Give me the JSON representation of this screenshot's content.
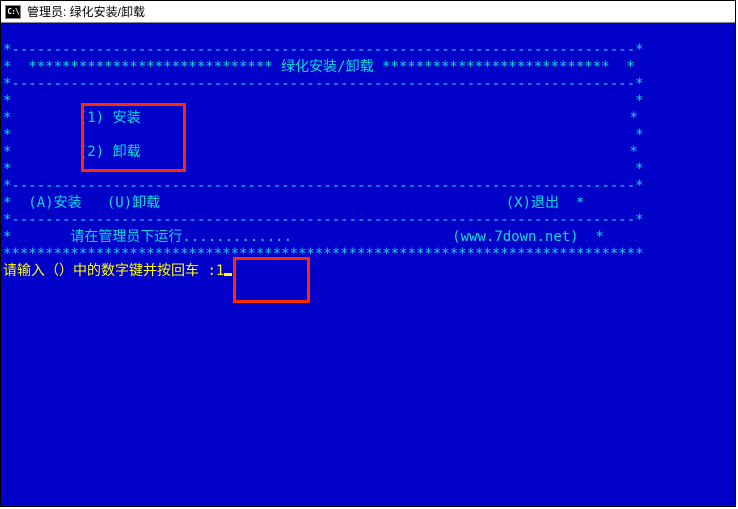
{
  "titlebar": {
    "icon_label": "C:\\",
    "title": "管理员:  绿化安装/卸载"
  },
  "console": {
    "top_border": "*--------------------------------------------------------------------------*",
    "header_line": "*  ***************************** 绿化安装/卸载 ***************************  *",
    "sep_line": "*--------------------------------------------------------------------------*",
    "blank_side": "*                                                                          *",
    "option1": "*        (1) 安装                                                          *",
    "option2": "*        (2) 卸载                                                          *",
    "menu_line_left": "*  (A)安装   (U)卸载",
    "menu_line_right": "(X)退出  *",
    "run_admin_left": "*       请在管理员下运行.............",
    "run_admin_right": "(www.7down.net)  *",
    "stars_line": "****************************************************************************",
    "prompt": "请输入（）中的数字键并按回车",
    "prompt_sep": ":",
    "input_value": "1"
  }
}
